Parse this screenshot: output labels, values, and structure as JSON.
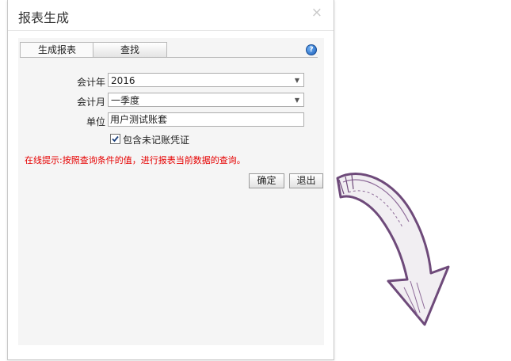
{
  "dialog": {
    "title": "报表生成",
    "close_icon": "close-icon"
  },
  "tabs": [
    {
      "label": "生成报表",
      "active": true
    },
    {
      "label": "查找",
      "active": false
    }
  ],
  "help": {
    "icon": "help-icon",
    "glyph": "?"
  },
  "form": {
    "year": {
      "label": "会计年",
      "value": "2016"
    },
    "month": {
      "label": "会计月",
      "value": "一季度"
    },
    "unit": {
      "label": "单位",
      "value": "用户测试账套"
    },
    "include_unposted": {
      "label": "包含未记账凭证",
      "checked": true
    }
  },
  "hint": "在线提示:按照查询条件的值，进行报表当前数据的查询。",
  "buttons": {
    "ok": "确定",
    "exit": "退出"
  },
  "colors": {
    "hint": "#e60000",
    "arrow_outline": "#6e4a7a"
  }
}
